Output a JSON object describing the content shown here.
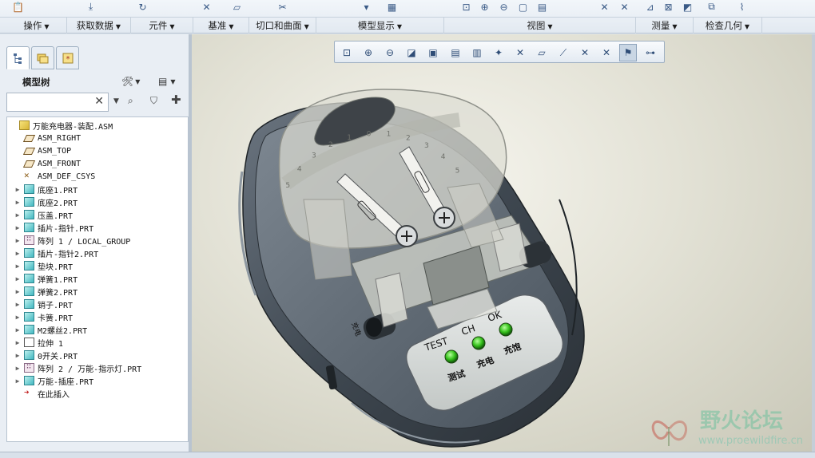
{
  "ribbon": {
    "groups": [
      {
        "label": "操作"
      },
      {
        "label": "获取数据"
      },
      {
        "label": "元件"
      },
      {
        "label": "基准"
      },
      {
        "label": "切口和曲面"
      },
      {
        "label": "模型显示"
      },
      {
        "label": "视图"
      },
      {
        "label": "测量"
      },
      {
        "label": "检查几何"
      }
    ]
  },
  "left_panel": {
    "title": "模型树",
    "search": {
      "value": "",
      "placeholder": ""
    },
    "tree": [
      {
        "label": "万能充电器-装配.ASM",
        "icon": "asm",
        "expand": false,
        "indent": 0
      },
      {
        "label": "ASM_RIGHT",
        "icon": "plane",
        "expand": false,
        "indent": 1
      },
      {
        "label": "ASM_TOP",
        "icon": "plane",
        "expand": false,
        "indent": 1
      },
      {
        "label": "ASM_FRONT",
        "icon": "plane",
        "expand": false,
        "indent": 1
      },
      {
        "label": "ASM_DEF_CSYS",
        "icon": "csys",
        "expand": false,
        "indent": 1
      },
      {
        "label": "底座1.PRT",
        "icon": "prt",
        "expand": true,
        "indent": 1
      },
      {
        "label": "底座2.PRT",
        "icon": "prt",
        "expand": true,
        "indent": 1
      },
      {
        "label": "压盖.PRT",
        "icon": "prt",
        "expand": true,
        "indent": 1
      },
      {
        "label": "插片-指针.PRT",
        "icon": "prt",
        "expand": true,
        "indent": 1
      },
      {
        "label": "阵列 1 / LOCAL_GROUP",
        "icon": "grp",
        "expand": true,
        "indent": 1
      },
      {
        "label": "插片-指针2.PRT",
        "icon": "prt",
        "expand": true,
        "indent": 1
      },
      {
        "label": "垫块.PRT",
        "icon": "prt",
        "expand": true,
        "indent": 1
      },
      {
        "label": "弹簧1.PRT",
        "icon": "prt",
        "expand": true,
        "indent": 1
      },
      {
        "label": "弹簧2.PRT",
        "icon": "prt",
        "expand": true,
        "indent": 1
      },
      {
        "label": "销子.PRT",
        "icon": "prt",
        "expand": true,
        "indent": 1
      },
      {
        "label": "卡簧.PRT",
        "icon": "prt",
        "expand": true,
        "indent": 1
      },
      {
        "label": "M2螺丝2.PRT",
        "icon": "prt",
        "expand": true,
        "indent": 1
      },
      {
        "label": "拉伸 1",
        "icon": "ext",
        "expand": true,
        "indent": 1
      },
      {
        "label": "0开关.PRT",
        "icon": "prt",
        "expand": true,
        "indent": 1
      },
      {
        "label": "阵列 2 / 万能-指示灯.PRT",
        "icon": "grp",
        "expand": true,
        "indent": 1
      },
      {
        "label": "万能-插座.PRT",
        "icon": "prt",
        "expand": true,
        "indent": 1
      },
      {
        "label": "在此插入",
        "icon": "ins",
        "expand": false,
        "indent": 1
      }
    ]
  },
  "model": {
    "panel_labels": {
      "test": "TEST",
      "ch": "CH",
      "ok": "OK",
      "cn_test": "测试",
      "cn_ch": "充电",
      "cn_ok": "充饱",
      "side": "充电"
    },
    "scale_numbers": [
      "5",
      "4",
      "3",
      "2",
      "1",
      "0",
      "1",
      "2",
      "3",
      "4",
      "5"
    ],
    "led_color": "#36c21c"
  },
  "watermark": {
    "title": "野火论坛",
    "url": "www.proewildfire.cn"
  },
  "colors": {
    "body": "#404a55",
    "cover": "#cfd0c6",
    "accent": "#39b54a"
  }
}
